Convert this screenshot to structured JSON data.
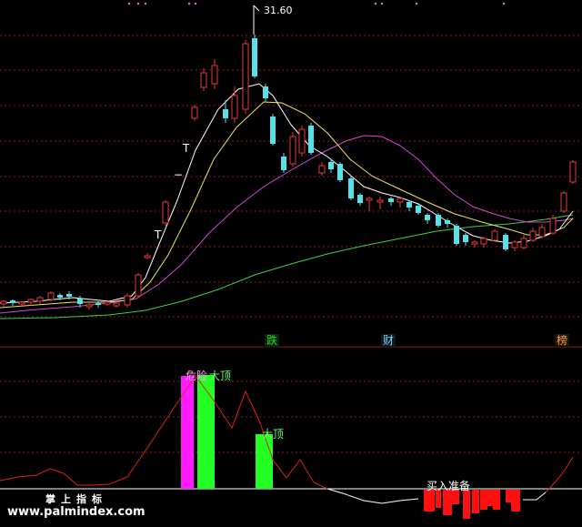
{
  "price_panel": {
    "high_marker": "31.60",
    "t_markers": [
      "T",
      "T",
      "T"
    ],
    "dash_marker": "−"
  },
  "event_tags": [
    {
      "text": "跌",
      "color": "#22dd22"
    },
    {
      "text": "财",
      "color": "#7fd4ff"
    },
    {
      "text": "榜",
      "color": "#ffa040"
    }
  ],
  "indicator_panel": {
    "labels": {
      "danger": "危险",
      "top": "大顶",
      "top2": "大顶",
      "buy_prep": "买入准备"
    }
  },
  "watermark": {
    "zh": "掌上指标",
    "url": "www.palmindex.com"
  },
  "colors": {
    "up": "#e23a3a",
    "down": "#56e0e8",
    "ma_white": "#ffffff",
    "ma_yellow": "#f2e35a",
    "ma_magenta": "#d646d6",
    "ma_green": "#3ad14a",
    "grid": "#8a1c1c",
    "magenta_bar": "#ff1aff",
    "green_bar": "#22ff22",
    "red_bar": "#ff1010"
  }
}
